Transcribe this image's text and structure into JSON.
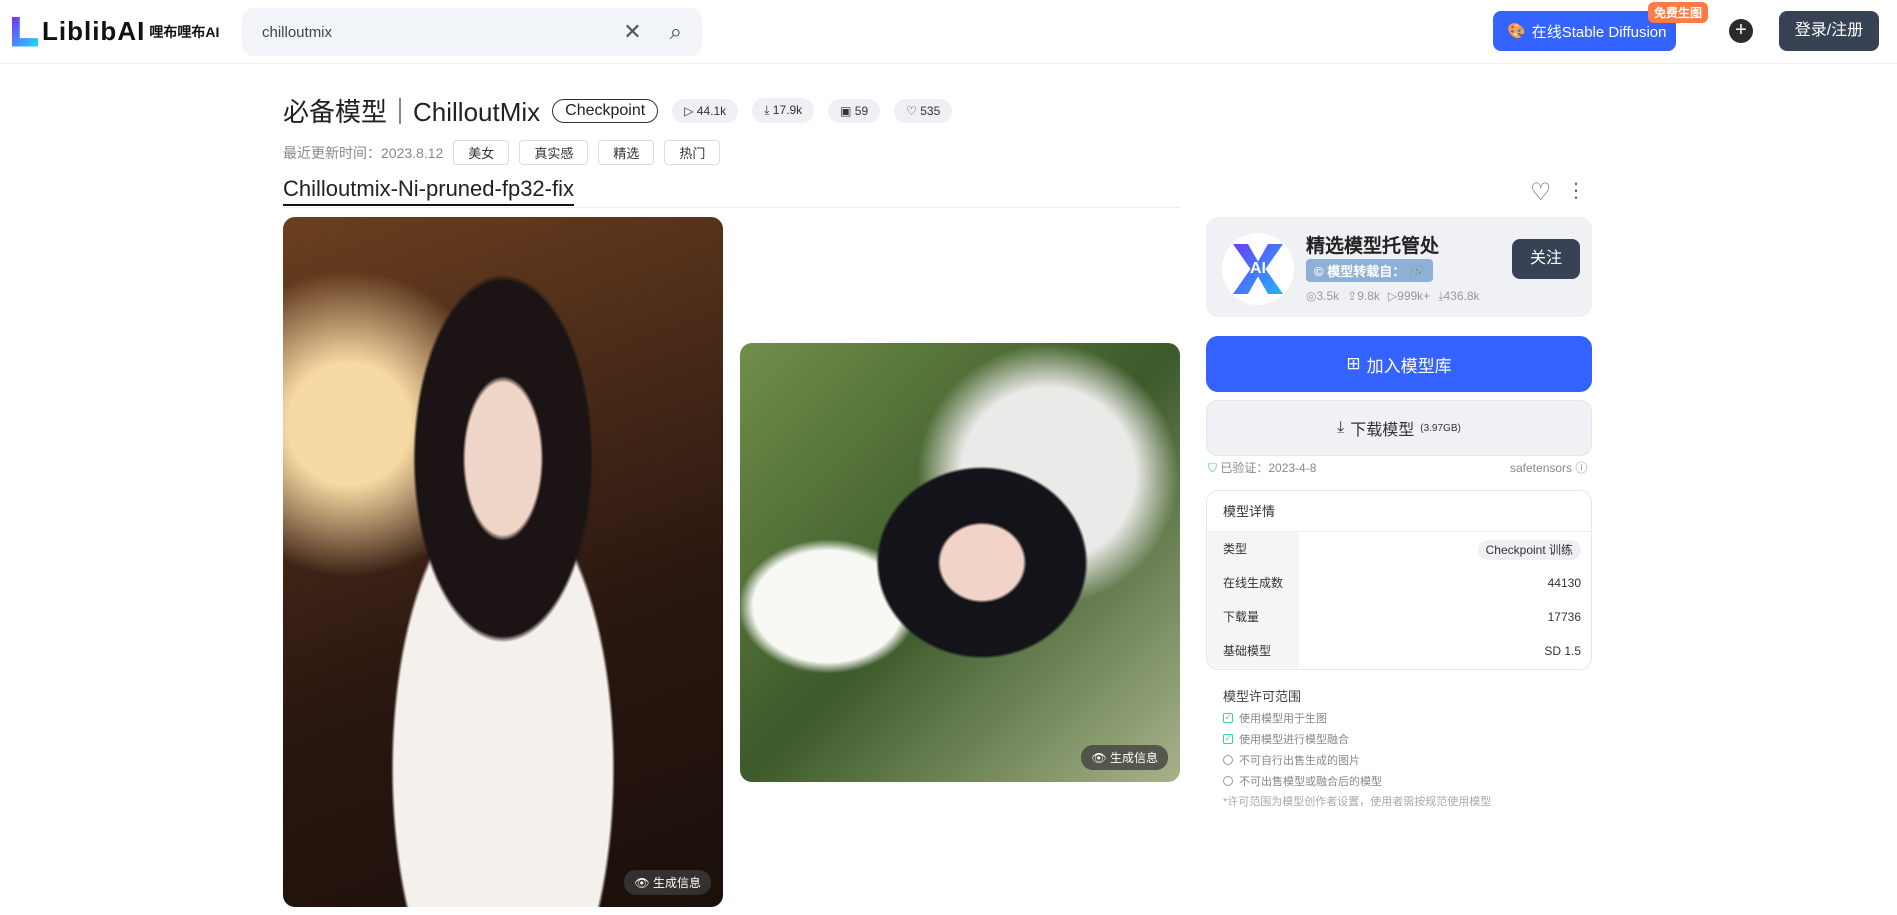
{
  "header": {
    "logo_text": "LiblibAI",
    "logo_cn": "哩布哩布AI",
    "search_value": "chilloutmix",
    "sd_button": "在线Stable Diffusion",
    "free_badge": "免费生图",
    "login": "登录/注册"
  },
  "model": {
    "title": "必备模型｜ChilloutMix",
    "type_chip": "Checkpoint",
    "stats": {
      "runs": "44.1k",
      "downloads": "17.9k",
      "images": "59",
      "likes": "535"
    },
    "updated": "最近更新时间：2023.8.12",
    "tags": [
      "美女",
      "真实感",
      "精选",
      "热门"
    ],
    "version": "Chilloutmix-Ni-pruned-fp32-fix"
  },
  "gallery": {
    "gen_info": "生成信息"
  },
  "creator": {
    "name": "精选模型托管处",
    "repost_label": "模型转载自：",
    "avatar_text": "AI",
    "followers": "3.5k",
    "uploads": "9.8k",
    "runs": "999k+",
    "downloads": "436.8k",
    "follow": "关注"
  },
  "actions": {
    "add": "加入模型库",
    "download": "下载模型",
    "size": "(3.97GB)",
    "verified": "已验证：2023-4-8",
    "format": "safetensors"
  },
  "details": {
    "title": "模型详情",
    "rows": [
      {
        "k": "类型",
        "v": "Checkpoint 训练"
      },
      {
        "k": "在线生成数",
        "v": "44130"
      },
      {
        "k": "下载量",
        "v": "17736"
      },
      {
        "k": "基础模型",
        "v": "SD 1.5"
      }
    ]
  },
  "license": {
    "title": "模型许可范围",
    "items": [
      {
        "text": "使用模型用于生图",
        "allowed": true
      },
      {
        "text": "使用模型进行模型融合",
        "allowed": true
      },
      {
        "text": "不可自行出售生成的图片",
        "allowed": false
      },
      {
        "text": "不可出售模型或融合后的模型",
        "allowed": false
      }
    ],
    "note": "*许可范围为模型创作者设置，使用者需按规范使用模型"
  }
}
